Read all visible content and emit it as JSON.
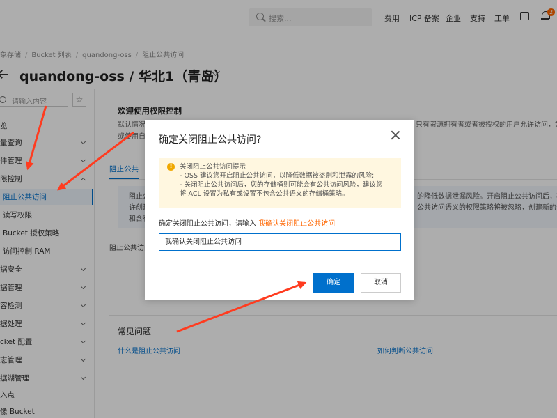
{
  "topbar": {
    "search_placeholder": "搜索...",
    "nav": [
      "费用",
      "ICP 备案",
      "企业",
      "支持",
      "工单"
    ],
    "badge_count": "2"
  },
  "breadcrumb": [
    "象存储",
    "Bucket 列表",
    "quandong-oss",
    "阻止公共访问"
  ],
  "page_title": "quandong-oss / 华北1（青岛）",
  "sidebar": {
    "search_placeholder": "请输入内容",
    "star": "☆",
    "items": [
      {
        "label": "览"
      },
      {
        "label": "量查询"
      },
      {
        "label": "件管理"
      },
      {
        "label": "限控制"
      },
      {
        "label": "阻止公共访问"
      },
      {
        "label": "读写权限"
      },
      {
        "label": "Bucket 授权策略"
      },
      {
        "label": "访问控制 RAM"
      },
      {
        "label": "据安全"
      },
      {
        "label": "据管理"
      },
      {
        "label": "容检测"
      },
      {
        "label": "据处理"
      },
      {
        "label": "cket 配置"
      },
      {
        "label": "志管理"
      },
      {
        "label": "据湖管理"
      },
      {
        "label": "入点"
      },
      {
        "label": "像 Bucket"
      }
    ]
  },
  "main": {
    "welcome_title": "欢迎使用权限控制",
    "welcome_line1": "默认情况",
    "welcome_line1_right": "只有资源拥有者或者被授权的用户允许访问，如",
    "welcome_line2": "或使用自",
    "tab_label": "阻止公共",
    "info_line1": "阻止公",
    "info_line2": "许创建",
    "info_line3": "和含有",
    "info_right1": "的降低数据泄漏风险。开启阻止公共访问后，将",
    "info_right2": "公共访问语义的权限策略将被忽略，创建新的公",
    "section_label": "阻止公共访问"
  },
  "faq": {
    "title": "常见问题",
    "link1": "什么是阻止公共访问",
    "link2": "如何判断公共访问"
  },
  "modal": {
    "title": "确定关闭阻止公共访问?",
    "warn_title": "关闭阻止公共访问提示",
    "warn_line1": "- OSS 建议您开启阻止公共访问，以降低数据被盗刷和泄露的风险;",
    "warn_line2": "- 关闭阻止公共访问后，您的存储桶则可能会有公共访问风险，建议您",
    "warn_line3": "将 ACL 设置为私有或设置不包含公共语义的存储桶策略。",
    "prompt_prefix": "确定关闭阻止公共访问，请输入",
    "prompt_highlight": "我确认关闭阻止公共访问",
    "input_value": "我确认关闭阻止公共访问",
    "ok_label": "确定",
    "cancel_label": "取消"
  },
  "colors": {
    "accent": "#0070cc",
    "highlight": "#ff6600",
    "arrow": "#ff3b1f"
  }
}
